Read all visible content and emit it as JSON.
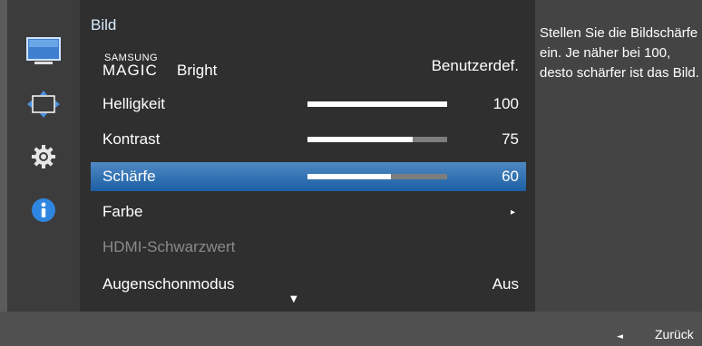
{
  "sidebar": {
    "icons": [
      {
        "name": "picture-icon",
        "active": true
      },
      {
        "name": "position-arrows-icon",
        "active": false
      },
      {
        "name": "gear-icon",
        "active": false
      },
      {
        "name": "info-icon",
        "active": false
      }
    ]
  },
  "menu": {
    "title": "Bild",
    "magic_bright": {
      "brand_small": "SAMSUNG",
      "brand_large": "MAGIC",
      "label": "Bright",
      "value": "Benutzerdef."
    },
    "items": [
      {
        "label": "Helligkeit",
        "value": "100",
        "level": 1.0
      },
      {
        "label": "Kontrast",
        "value": "75",
        "level": 0.75
      },
      {
        "label": "Schärfe",
        "value": "60",
        "level": 0.6
      },
      {
        "label": "Farbe",
        "arrow": "▸"
      },
      {
        "label": "HDMI-Schwarzwert"
      },
      {
        "label": "Augenschonmodus",
        "value": "Aus"
      }
    ],
    "scroll_indicator": "▼"
  },
  "help": {
    "text": "Stellen Sie die Bildschärfe ein. Je näher bei 100, desto schärfer ist das Bild."
  },
  "footer": {
    "back_arrow": "◄",
    "back_label": "Zurück"
  },
  "colors": {
    "accent": "#3574b3",
    "title": "#d8ecff",
    "disabled": "#8a8a8a"
  }
}
